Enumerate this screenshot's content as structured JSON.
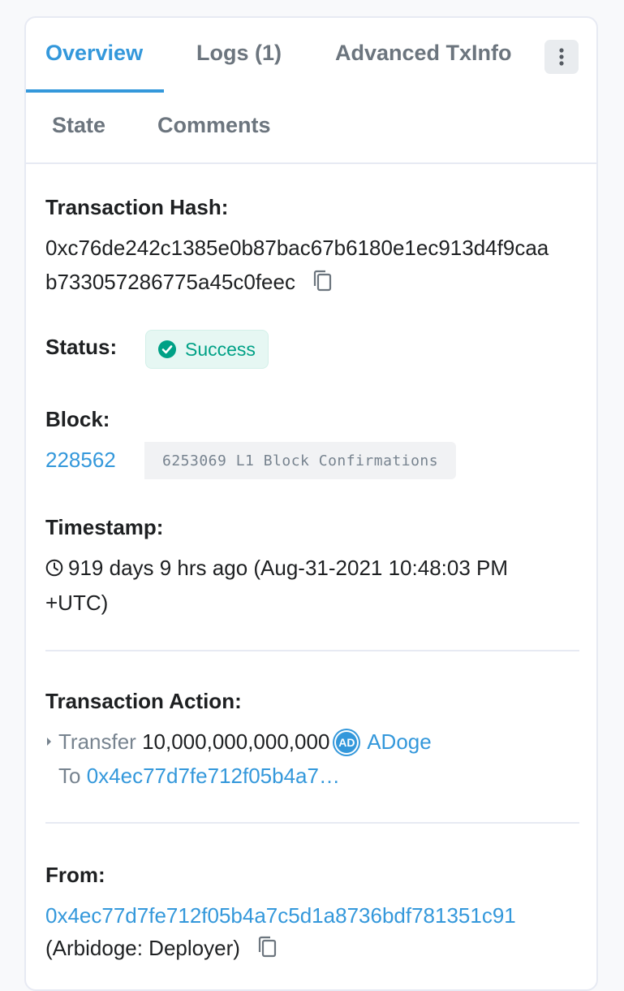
{
  "tabs": {
    "overview": "Overview",
    "logs": "Logs (1)",
    "advanced": "Advanced TxInfo",
    "state": "State",
    "comments": "Comments"
  },
  "tx": {
    "hash_label": "Transaction Hash:",
    "hash_line1": "0xc76de242c1385e0b87bac67b6180e1ec913d4f9caa",
    "hash_line2": "b733057286775a45c0feec",
    "status_label": "Status:",
    "status_value": "Success",
    "block_label": "Block:",
    "block_number": "228562",
    "block_confirmations": "6253069 L1 Block Confirmations",
    "timestamp_label": "Timestamp:",
    "timestamp_line1": "919 days 9 hrs ago (Aug-31-2021 10:48:03 PM",
    "timestamp_line2": "+UTC)",
    "action_label": "Transaction Action:",
    "action_verb": "Transfer",
    "action_amount": "10,000,000,000,000",
    "action_token": "ADoge",
    "action_token_icon_text": "AD",
    "action_to_label": "To",
    "action_to_address": "0x4ec77d7fe712f05b4a7…",
    "from_label": "From:",
    "from_address": "0x4ec77d7fe712f05b4a7c5d1a8736bdf781351c91",
    "from_name": "(Arbidoge: Deployer)"
  },
  "colors": {
    "accent": "#3498db",
    "success": "#00a186",
    "success_bg": "#e6f7f3",
    "muted": "#77838f"
  },
  "icons": [
    "more-vertical-icon",
    "copy-icon",
    "check-circle-icon",
    "clock-icon",
    "caret-right-icon",
    "adoge-token-icon"
  ]
}
